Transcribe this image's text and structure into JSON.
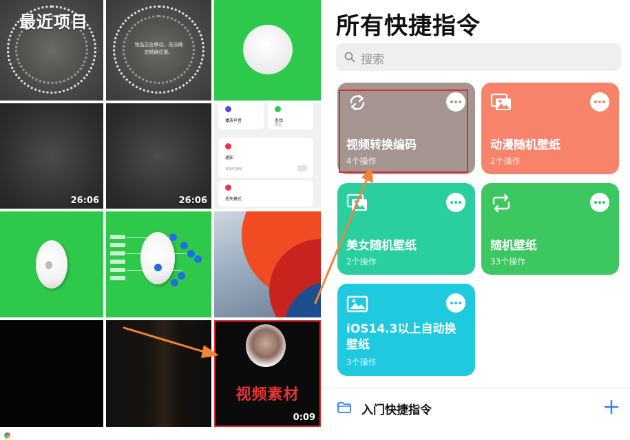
{
  "photos": {
    "album_title": "最近项目",
    "notice_text": "物品正在移动，无法确定精确位置。",
    "durations": [
      "26:06",
      "26:06",
      "0:09"
    ],
    "settings_items": [
      {
        "label": "播放声音",
        "color": "#5b4bd6"
      },
      {
        "label": "查找",
        "sub": "附近",
        "color": "#2ec94a"
      },
      {
        "label": "通知",
        "color": "#e8374a"
      },
      {
        "label": "通知",
        "sub": "发现时通知",
        "color": "#e8374a"
      },
      {
        "label": "丢失模式",
        "color": "#e8374a"
      }
    ],
    "overlay_caption": "视频素材"
  },
  "shortcuts": {
    "title": "所有快捷指令",
    "search_placeholder": "搜索",
    "tiles": [
      {
        "name": "视频转换编码",
        "count": "4个操作",
        "color": "#a49590",
        "icon": "convert-icon"
      },
      {
        "name": "动漫随机壁纸",
        "count": "2个操作",
        "color": "#f7836a",
        "icon": "photos-icon"
      },
      {
        "name": "美女随机壁纸",
        "count": "2个操作",
        "color": "#2acf9f",
        "icon": "photos-icon"
      },
      {
        "name": "随机壁纸",
        "count": "33个操作",
        "color": "#3cc761",
        "icon": "repeat-icon"
      },
      {
        "name": "iOS14.3以上自动换壁纸",
        "count": "3个操作",
        "color": "#1fc9e0",
        "icon": "photo-icon"
      }
    ],
    "footer": {
      "label": "入门快捷指令",
      "accent": "#2f7cf6"
    }
  },
  "annotations": {
    "highlight_color": "#e02b2b",
    "arrow_color": "#f4823a"
  }
}
